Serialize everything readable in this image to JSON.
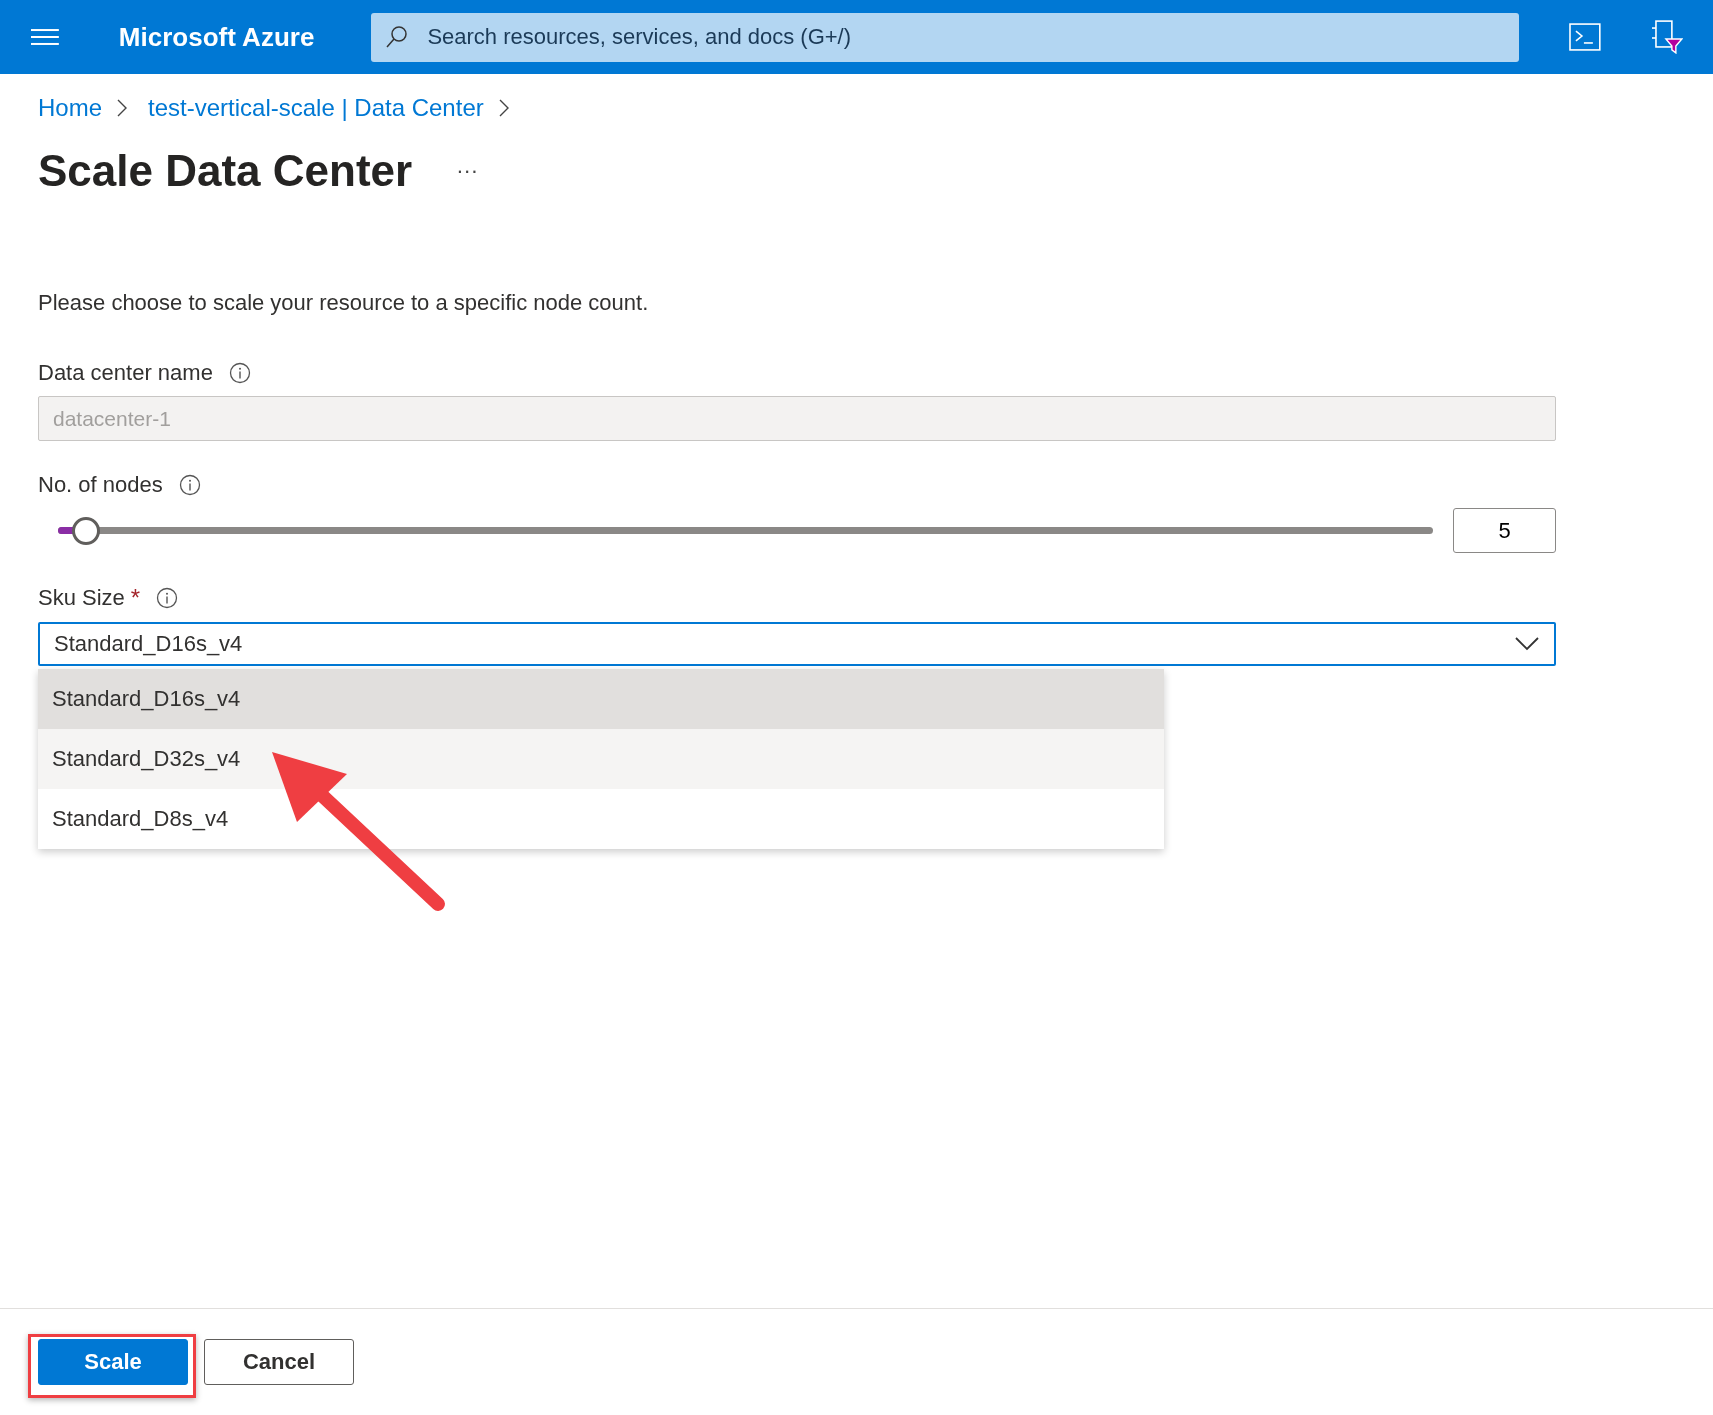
{
  "top_bar": {
    "brand": "Microsoft Azure",
    "search": {
      "placeholder": "Search resources, services, and docs (G+/)"
    }
  },
  "breadcrumb": [
    "Home",
    "test-vertical-scale | Data Center"
  ],
  "page": {
    "title": "Scale Data Center",
    "more": "···"
  },
  "description": "Please choose to scale your resource to a specific node count.",
  "fields": [
    {
      "kind": "text",
      "label": "Data center name",
      "value": "datacenter-1",
      "disabled": true
    },
    {
      "kind": "slider",
      "label": "No. of nodes",
      "level": 0.02,
      "value": "5"
    },
    {
      "kind": "dropdown",
      "label": "Sku Size",
      "required_mark": "*",
      "value": "Standard_D16s_v4",
      "expanded": true,
      "options": [
        {
          "label": "Standard_D16s_v4",
          "selected": true,
          "hovered": false
        },
        {
          "label": "Standard_D32s_v4",
          "selected": false,
          "hovered": true
        },
        {
          "label": "Standard_D8s_v4",
          "selected": false,
          "hovered": false
        }
      ]
    }
  ],
  "buttons": [
    {
      "label": "Scale",
      "kind": "primary"
    },
    {
      "label": "Cancel",
      "kind": "secondary"
    }
  ],
  "annotations": {
    "arrow": true,
    "highlight": true
  }
}
